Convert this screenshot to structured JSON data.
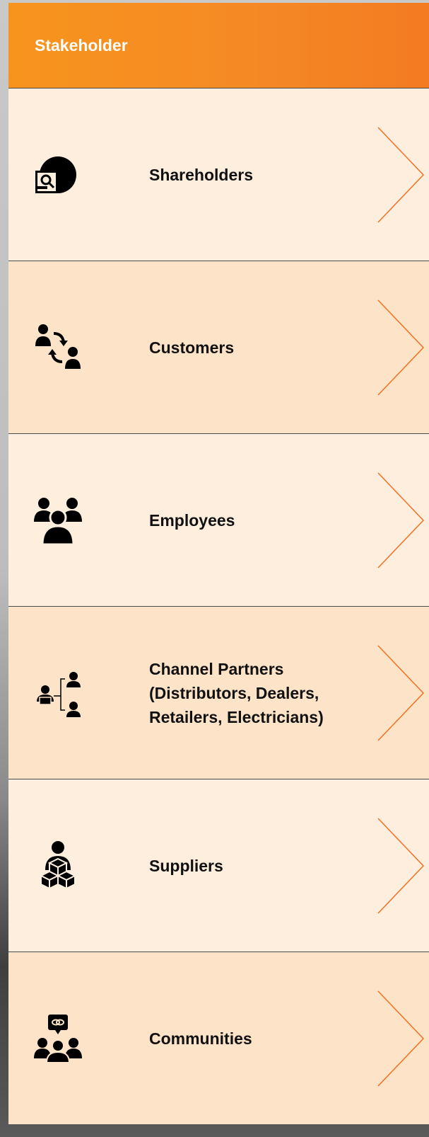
{
  "header": {
    "title": "Stakeholder"
  },
  "colors": {
    "accent": "#f58a24",
    "row_light": "#fdeede",
    "row_dark": "#fde3c8",
    "chevron": "#f37021"
  },
  "stakeholders": [
    {
      "label": "Shareholders",
      "icon": "shareholder-icon"
    },
    {
      "label": "Customers",
      "icon": "customer-exchange-icon"
    },
    {
      "label": "Employees",
      "icon": "employees-group-icon"
    },
    {
      "label": "Channel Partners (Distributors, Dealers, Retailers, Electricians)",
      "icon": "channel-network-icon"
    },
    {
      "label": "Suppliers",
      "icon": "supplier-boxes-icon"
    },
    {
      "label": "Communities",
      "icon": "community-chat-icon"
    }
  ]
}
